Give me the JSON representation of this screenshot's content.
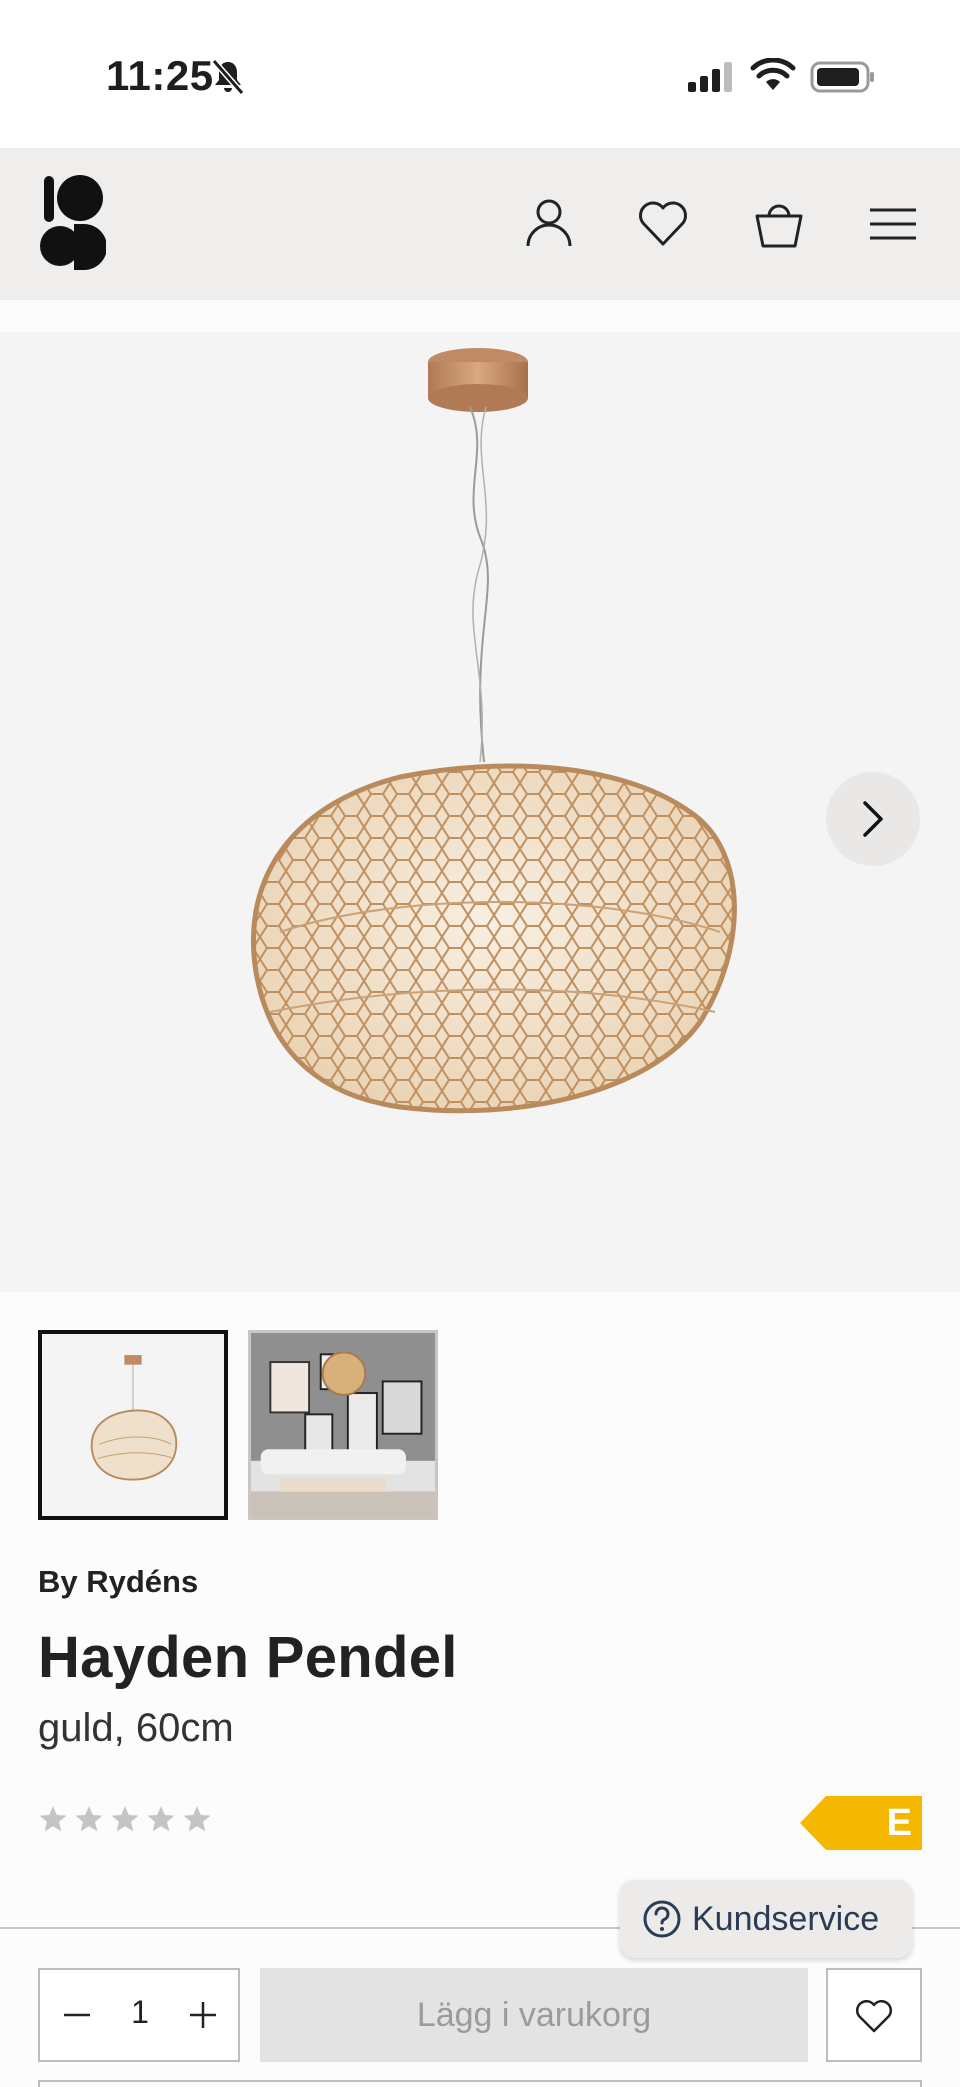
{
  "status_bar": {
    "time": "11:25",
    "icons": [
      "bell-slash-icon",
      "cellular-signal-icon",
      "wifi-icon",
      "battery-icon"
    ]
  },
  "header": {
    "logo": "S",
    "icons": [
      "user-icon",
      "heart-icon",
      "shopping-bag-icon",
      "menu-icon"
    ]
  },
  "gallery": {
    "images": 2,
    "selected": 1,
    "next_icon": "chevron-right-icon"
  },
  "product": {
    "brand": "By Rydéns",
    "title": "Hayden Pendel",
    "variant": "guld, 60cm",
    "rating_stars": 5,
    "energy_class": "E"
  },
  "support": {
    "label": "Kundservice",
    "icon": "question-circle-icon"
  },
  "purchase": {
    "quantity": "1",
    "add_to_cart_label": "Lägg i varukorg",
    "wishlist_icon": "heart-icon"
  },
  "colors": {
    "header_bg": "#efeeed",
    "energy_badge": "#f5b800",
    "button_disabled_bg": "#e3e3e3",
    "lamp_gold": "#c9a070"
  }
}
